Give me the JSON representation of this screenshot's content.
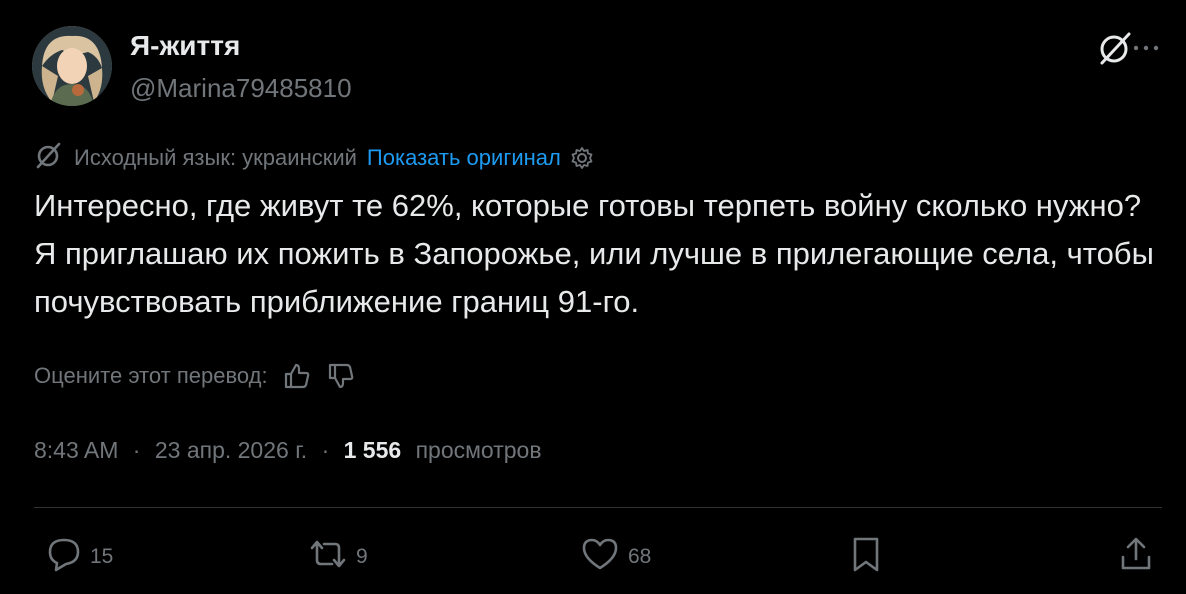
{
  "author": {
    "display_name": "Я-життя",
    "handle": "@Marina79485810"
  },
  "header_icons": [
    "grok-icon",
    "more-icon"
  ],
  "translation": {
    "source_language": "Исходный язык: украинский",
    "show_original": "Показать оригинал"
  },
  "tweet": {
    "text": "Интересно, где живут те 62%, которые готовы терпеть войну сколько нужно? Я приглашаю их пожить в Запорожье, или лучше в прилегающие села, чтобы почувствовать приближение границ 91-го."
  },
  "rating": {
    "label": "Оцените этот перевод:"
  },
  "meta": {
    "time": "8:43 AM",
    "date": "23 апр. 2026 г.",
    "views_count": "1 556",
    "views_label": "просмотров",
    "separator": "·"
  },
  "actions": {
    "replies": "15",
    "reposts": "9",
    "likes": "68"
  },
  "colors": {
    "background": "#000000",
    "text": "#e7e9ea",
    "secondary": "#71767b",
    "link": "#1d9bf0",
    "divider": "#2f3336"
  }
}
